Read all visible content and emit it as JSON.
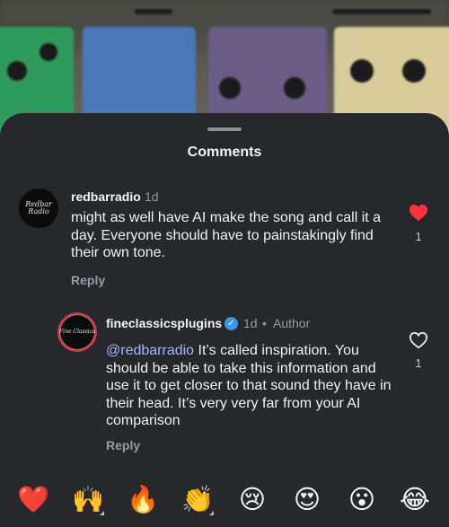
{
  "sheet": {
    "title": "Comments"
  },
  "comments": [
    {
      "avatar_text": "Redbar Radio",
      "username": "redbarradio",
      "time": "1d",
      "text": "might as well have AI make the song and call it a day. Everyone should have to painstakingly find their own tone.",
      "reply_label": "Reply",
      "likes": "1",
      "liked": true,
      "like_color": "#ff3040"
    },
    {
      "avatar_text": "Fine Classics",
      "username": "fineclassicsplugins",
      "verified": true,
      "time": "1d",
      "separator": "•",
      "role": "Author",
      "mention": "@redbarradio",
      "text": " It’s called inspiration. You should be able to take this information and use it to get closer to that sound they have in their head. It’s very very far from your AI comparison",
      "reply_label": "Reply",
      "likes": "1",
      "liked": false
    }
  ],
  "reactions": [
    {
      "emoji": "❤️",
      "name": "red-heart"
    },
    {
      "emoji": "🙌",
      "name": "raising-hands"
    },
    {
      "emoji": "🔥",
      "name": "fire"
    },
    {
      "emoji": "👏",
      "name": "clapping-hands"
    },
    {
      "emoji": "😢",
      "name": "crying-face"
    },
    {
      "emoji": "😍",
      "name": "heart-eyes-face"
    },
    {
      "emoji": "😮",
      "name": "surprised-face"
    },
    {
      "emoji": "😂",
      "name": "tears-of-joy-face"
    }
  ],
  "colors": {
    "sheet_background": "#27282c",
    "mention": "#a7b5ff",
    "verified_badge": "#3897f0",
    "muted_text": "#9a9ba1"
  },
  "icons": {
    "like_filled": "heart-filled-icon",
    "like_outline": "heart-outline-icon",
    "verified": "verified-badge-icon"
  }
}
